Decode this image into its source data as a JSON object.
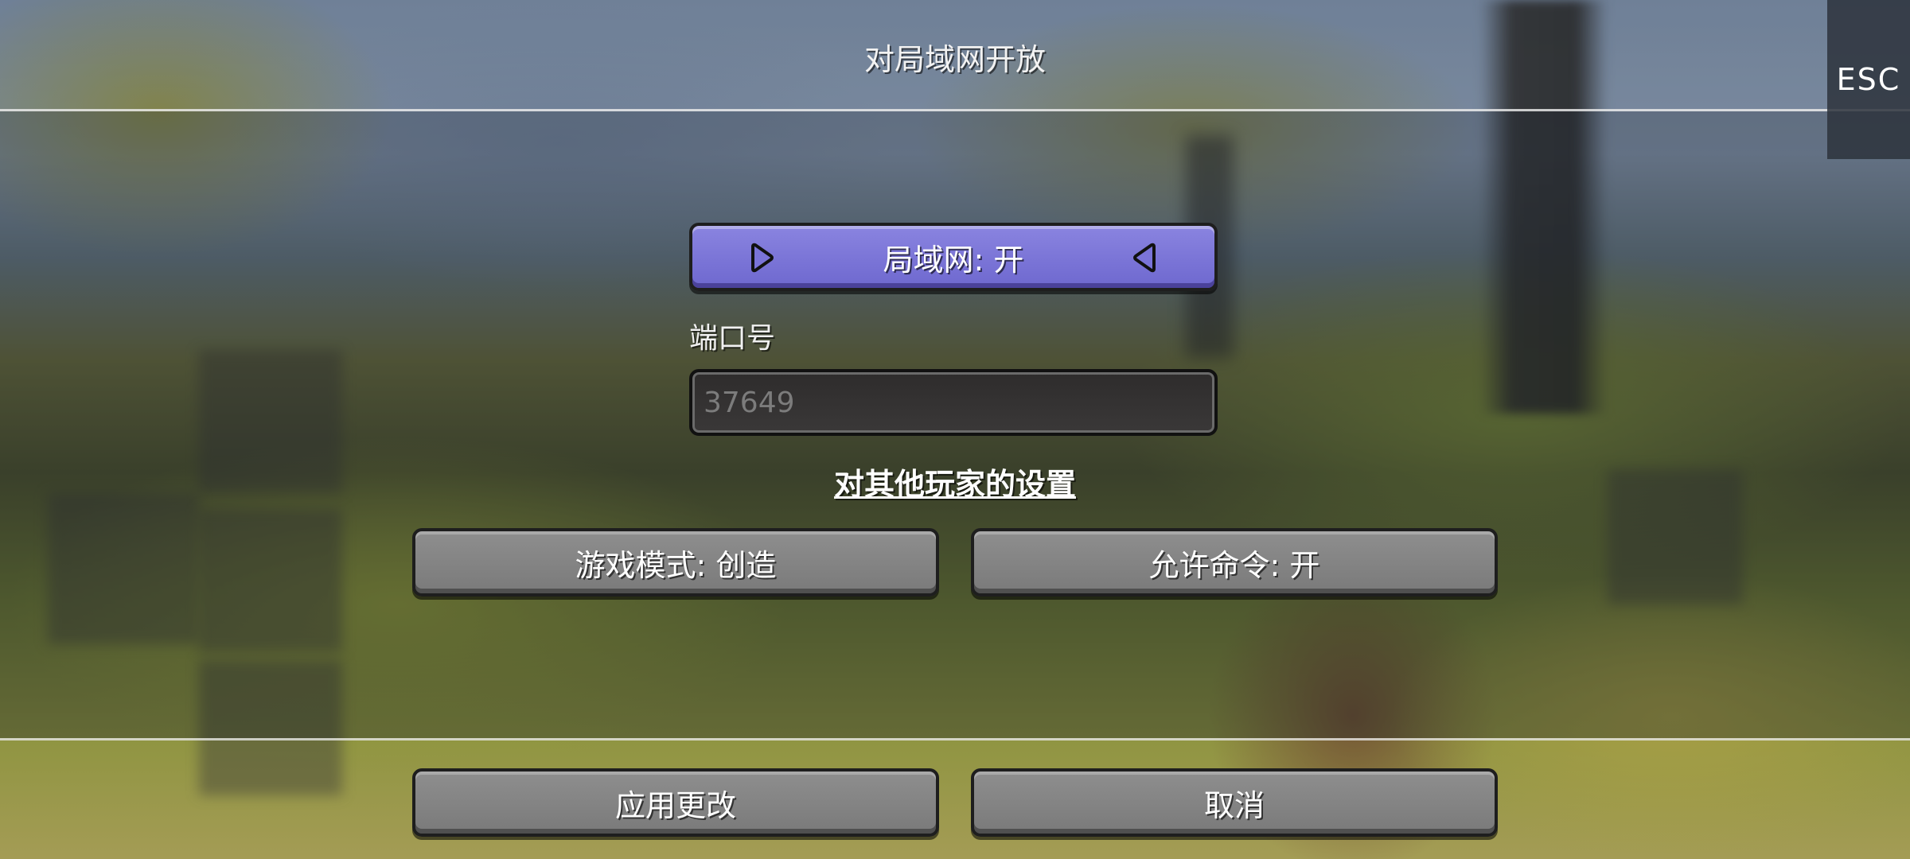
{
  "header": {
    "title": "对局域网开放",
    "esc_label": "ESC"
  },
  "lan": {
    "toggle_label": "局域网: 开"
  },
  "port": {
    "label": "端口号",
    "placeholder": "37649",
    "value": ""
  },
  "settings": {
    "heading": "对其他玩家的设置",
    "game_mode_label": "游戏模式: 创造",
    "allow_commands_label": "允许命令: 开"
  },
  "footer": {
    "apply_label": "应用更改",
    "cancel_label": "取消"
  },
  "colors": {
    "toggle_accent": "#7a74d8",
    "button_gray": "#858585",
    "input_bg": "#333131"
  },
  "icons": {
    "left_arrow": "play-right-icon",
    "right_arrow": "play-left-icon"
  }
}
